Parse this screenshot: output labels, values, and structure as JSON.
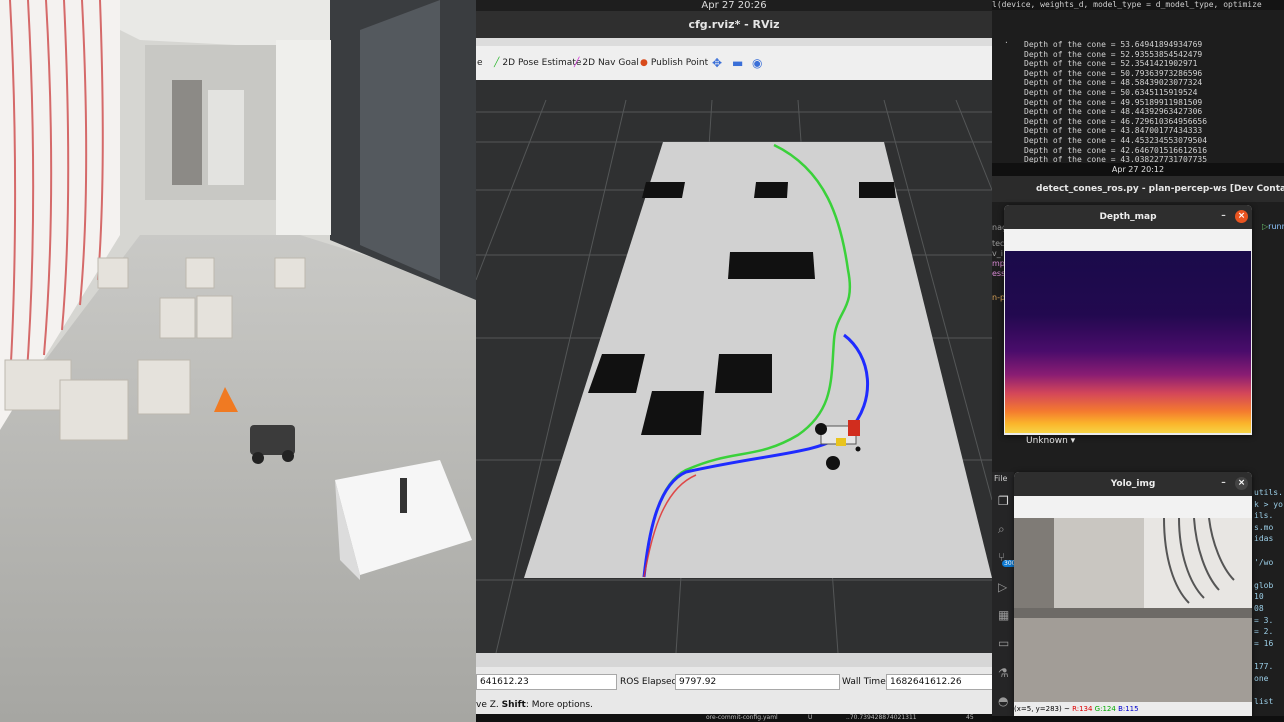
{
  "rviz": {
    "clock": "Apr 27  20:26",
    "window_title": "cfg.rviz* - RViz",
    "toolbar": {
      "partial_item": "e",
      "pose_estimate": "2D Pose Estimate",
      "nav_goal": "2D Nav Goal",
      "publish_point": "Publish Point",
      "move_icon": "move-icon",
      "zoom_out_icon": "minus-icon",
      "focus_icon": "focus-icon"
    },
    "status": {
      "ros_time_value": "641612.23",
      "ros_elapsed_label": "ROS Elapsed:",
      "ros_elapsed_value": "9797.92",
      "wall_time_label": "Wall Time:",
      "wall_time_value": "1682641612.26",
      "hint_prefix": "ve Z. ",
      "hint_shift": "Shift",
      "hint_rest": ": More options."
    },
    "colors": {
      "planned_path": "#3ad13a",
      "actual_path": "#1f2bff",
      "overlap_path": "#e03030"
    }
  },
  "terminal": {
    "header_line": "l(device, weights_d, model_type = d_model_type, optimize",
    "lines": [
      "Depth of the cone = 53.64941894934769",
      "Depth of the cone = 52.93553854542479",
      "Depth of the cone = 52.3541421902971",
      "Depth of the cone = 50.79363973286596",
      "Depth of the cone = 48.58439023077324",
      "Depth of the cone = 50.6345115919524",
      "Depth of the cone = 49.95189911981509",
      "Depth of the cone = 48.44392963427306",
      "Depth of the cone = 46.729610364956656",
      "Depth of the cone = 43.84700177434333",
      "Depth of the cone = 44.453234553079504",
      "Depth of the cone = 42.646701516612616",
      "Depth of the cone = 43.038227731707735"
    ]
  },
  "vscode": {
    "clock": "Apr 27  20:12",
    "window_title": "detect_cones_ros.py - plan-percep-ws [Dev Container] - Vi",
    "left_fragments": [
      "nag",
      "tec",
      "v_i",
      "mpo",
      "ess",
      "n-p"
    ],
    "right_fragments": [
      "runn"
    ],
    "file_menu": "File",
    "badge_count": "300",
    "dropdown": "Unknown",
    "right_code": [
      "utils.",
      "k > yo",
      "ils.",
      "s.mo",
      "idas",
      "",
      "'/wo",
      "",
      "glob",
      "10",
      "08",
      "= 3.",
      "= 2.",
      "= 16",
      "",
      "177.",
      "one",
      "",
      "list"
    ],
    "bottom_fragments": [
      "ore-commit-config.yaml",
      "U",
      "..70.739428874021311",
      "45"
    ]
  },
  "depth_window": {
    "title": "Depth_map",
    "minimize": "–",
    "close": "×"
  },
  "yolo_window": {
    "title": "Yolo_img",
    "minimize": "–",
    "close": "×",
    "status": "(x=5, y=283) ~ ",
    "r": "R:134",
    "g": "G:124",
    "b": "B:115"
  }
}
